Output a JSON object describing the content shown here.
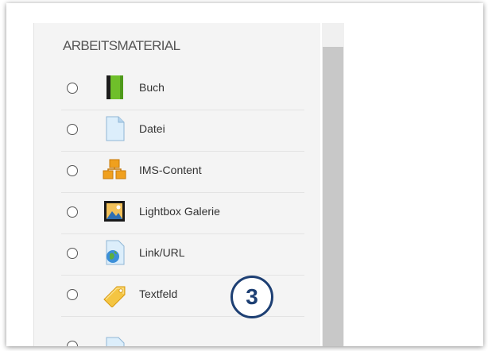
{
  "section": {
    "title": "ARBEITSMATERIAL"
  },
  "items": [
    {
      "label": "Buch",
      "icon": "book-icon",
      "selected": false
    },
    {
      "label": "Datei",
      "icon": "file-icon",
      "selected": false
    },
    {
      "label": "IMS-Content",
      "icon": "ims-content-icon",
      "selected": false
    },
    {
      "label": "Lightbox Galerie",
      "icon": "image-gallery-icon",
      "selected": false
    },
    {
      "label": "Link/URL",
      "icon": "link-url-icon",
      "selected": false
    },
    {
      "label": "Textfeld",
      "icon": "label-tag-icon",
      "selected": false
    }
  ],
  "annotation": {
    "number": "3",
    "color": "#1d3f73"
  }
}
